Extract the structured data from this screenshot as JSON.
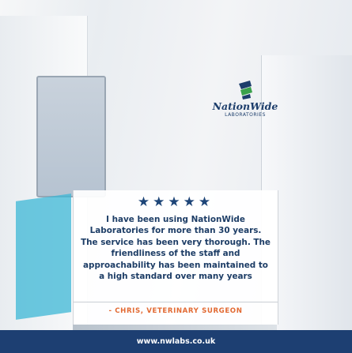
{
  "badge": {
    "brand_line": "NationWide",
    "sub_line": "LABORATORIES"
  },
  "card": {
    "rating_stars": 5,
    "stars_text": "★★★★★",
    "quote": "I have been using NationWide\nLaboratories for more than 30 years.\nThe service has been very thorough. The\nfriendliness of the staff and\napproachability has been maintained to\na high standard over many years",
    "author": "- CHRIS, VETERINARY SURGEON"
  },
  "footer": {
    "url": "www.nwlabs.co.uk"
  },
  "colors": {
    "brand_navy": "#1d3f72",
    "accent_orange": "#e26a33",
    "logo_green": "#3aa14b"
  }
}
